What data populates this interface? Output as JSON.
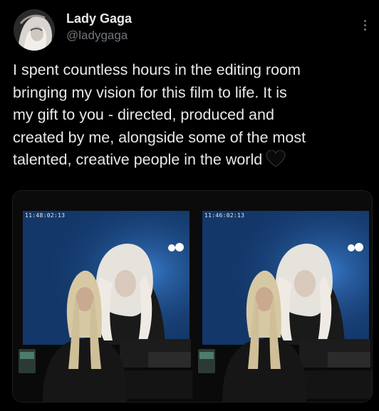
{
  "tweet": {
    "author": {
      "display_name": "Lady Gaga",
      "handle": "@ladygaga",
      "avatar_icon": "profile-avatar"
    },
    "more_icon": "more-vertical-icon",
    "text": "I spent countless hours in the editing room\nbringing my vision for this film to life. It is\nmy gift to you - directed, produced and\ncreated by me, alongside some of the most\ntalented, creative people in the world",
    "emoji": "black-heart-icon",
    "media": [
      {
        "timecode": "11:48:02:13"
      },
      {
        "timecode": "11:46:02:13"
      }
    ]
  },
  "colors": {
    "background": "#000000",
    "text_primary": "#e7e9ea",
    "text_secondary": "#71767b",
    "screen_blue": "#1d4f8a"
  }
}
